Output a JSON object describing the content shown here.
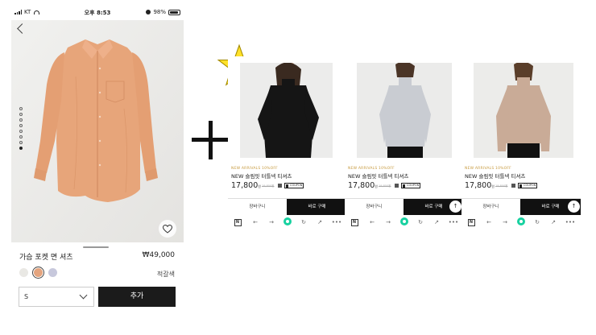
{
  "status_bar": {
    "carrier": "KT",
    "time": "오후 8:53",
    "battery": "98%"
  },
  "product": {
    "name": "가슴 포켓 면 셔츠",
    "price": "₩49,000",
    "color_name": "적갈색",
    "size_value": "S",
    "add_label": "추가",
    "image_count": 8,
    "active_image": 8
  },
  "swatches": [
    {
      "name": "white",
      "hex": "#e9e8e4",
      "selected": false
    },
    {
      "name": "orange",
      "hex": "#e4a47e",
      "selected": true
    },
    {
      "name": "lavender",
      "hex": "#c7c8dc",
      "selected": false
    }
  ],
  "cards": [
    {
      "brand": "NEW ARRIVALS 10%OFF",
      "title": "NEW 슬림핏 터틀넥 티셔츠",
      "price": "17,800",
      "won": "원",
      "orig": "19,800원",
      "coupon": "COUPON",
      "cart": "장바구니",
      "buy": "바로 구매",
      "top_icon": "arrow-up-icon",
      "garment_hex": "#151515"
    },
    {
      "brand": "NEW ARRIVALS 10%OFF",
      "title": "NEW 슬림핏 터틀넥 티셔츠",
      "price": "17,800",
      "won": "원",
      "orig": "19,800원",
      "coupon": "COUPON",
      "cart": "장바구니",
      "buy": "바로 구매",
      "top_icon": "arrow-up-icon",
      "garment_hex": "#c9ccd2"
    },
    {
      "brand": "NEW ARRIVALS 10%OFF",
      "title": "NEW 슬림핏 터틀넥 티셔츠",
      "price": "17,800",
      "won": "원",
      "orig": "19,800원",
      "coupon": "COUPON",
      "cart": "장바구니",
      "buy": "바로 구매",
      "top_icon": "arrow-up-icon",
      "garment_hex": "#c9ab97"
    }
  ],
  "browser_nav": {
    "n_label": "N",
    "more": "•••"
  },
  "accents": {
    "shirt": "#e7a57a",
    "star": "#ffe12a",
    "nav_green": "#17d1a0",
    "buy_black": "#111111"
  }
}
